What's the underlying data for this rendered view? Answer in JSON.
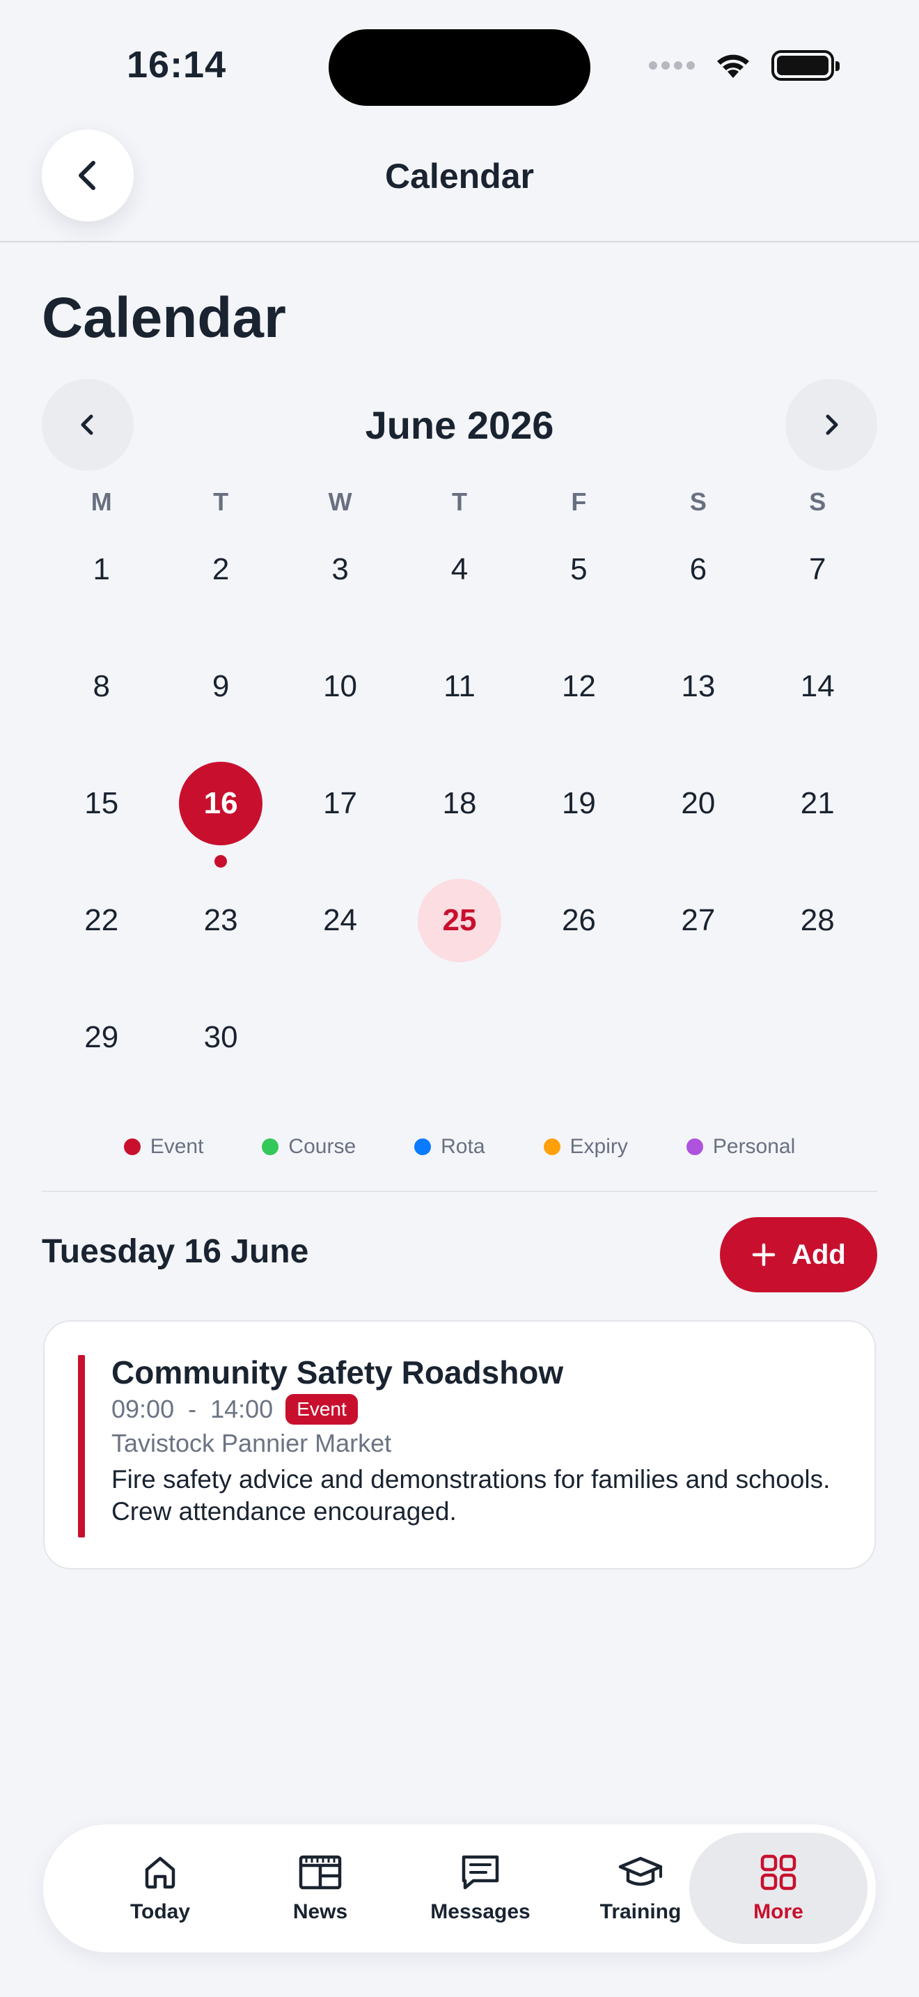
{
  "status_bar": {
    "time": "16:14"
  },
  "nav": {
    "title": "Calendar",
    "back_icon": "chevron-left-icon"
  },
  "page": {
    "title": "Calendar"
  },
  "calendar": {
    "month_label": "June 2026",
    "weekdays": [
      "M",
      "T",
      "W",
      "T",
      "F",
      "S",
      "S"
    ],
    "days": [
      "1",
      "2",
      "3",
      "4",
      "5",
      "6",
      "7",
      "8",
      "9",
      "10",
      "11",
      "12",
      "13",
      "14",
      "15",
      "16",
      "17",
      "18",
      "19",
      "20",
      "21",
      "22",
      "23",
      "24",
      "25",
      "26",
      "27",
      "28",
      "29",
      "30"
    ],
    "selected_day": "16",
    "today": "25",
    "event_days": [
      "16"
    ]
  },
  "legend": [
    {
      "label": "Event",
      "color": "#c8102e"
    },
    {
      "label": "Course",
      "color": "#34c759"
    },
    {
      "label": "Rota",
      "color": "#0a7aff"
    },
    {
      "label": "Expiry",
      "color": "#ff9f0a"
    },
    {
      "label": "Personal",
      "color": "#af52de"
    }
  ],
  "day_view": {
    "heading": "Tuesday 16 June",
    "add_label": "Add",
    "events": [
      {
        "title": "Community Safety Roadshow",
        "start": "09:00",
        "separator": "-",
        "end": "14:00",
        "badge": "Event",
        "location": "Tavistock Pannier Market",
        "description": "Fire safety advice and demonstrations for families and schools. Crew attendance encouraged."
      }
    ]
  },
  "tabbar": {
    "tabs": [
      {
        "label": "Today",
        "icon": "home-icon"
      },
      {
        "label": "News",
        "icon": "newspaper-icon"
      },
      {
        "label": "Messages",
        "icon": "message-icon"
      },
      {
        "label": "Training",
        "icon": "graduation-cap-icon"
      },
      {
        "label": "More",
        "icon": "grid-icon",
        "active": true
      }
    ]
  },
  "colors": {
    "accent": "#c8102e",
    "today_bg": "#fbdde2",
    "background": "#f4f5f9"
  }
}
